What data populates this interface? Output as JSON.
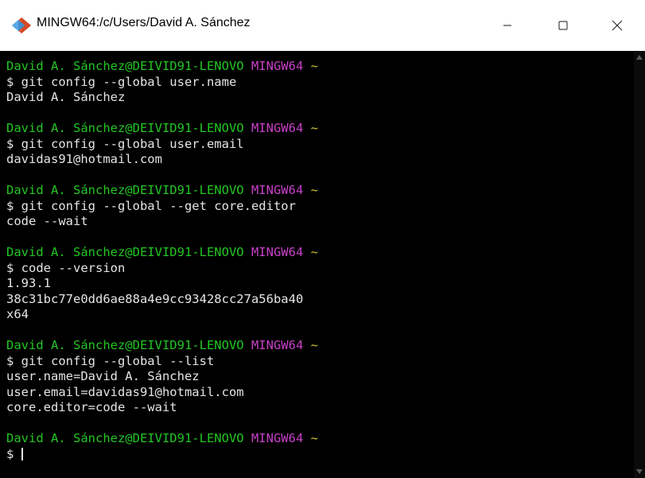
{
  "window": {
    "title": "MINGW64:/c/Users/David A. Sánchez",
    "app_icon": "git-bash-icon",
    "buttons": {
      "minimize_icon": "minimize-icon",
      "maximize_icon": "maximize-icon",
      "close_icon": "close-icon"
    }
  },
  "colors": {
    "user_host": "#23c623",
    "system": "#c840c8",
    "tilde": "#d6c43a",
    "text": "#e5e5e5",
    "background": "#000000"
  },
  "terminal": {
    "blocks": [
      {
        "prompt": {
          "user_host": "David A. Sánchez@DEIVID91-LENOVO",
          "system": "MINGW64",
          "path": "~"
        },
        "command": "$ git config --global user.name",
        "output": [
          "David A. Sánchez"
        ]
      },
      {
        "prompt": {
          "user_host": "David A. Sánchez@DEIVID91-LENOVO",
          "system": "MINGW64",
          "path": "~"
        },
        "command": "$ git config --global user.email",
        "output": [
          "davidas91@hotmail.com"
        ]
      },
      {
        "prompt": {
          "user_host": "David A. Sánchez@DEIVID91-LENOVO",
          "system": "MINGW64",
          "path": "~"
        },
        "command": "$ git config --global --get core.editor",
        "output": [
          "code --wait"
        ]
      },
      {
        "prompt": {
          "user_host": "David A. Sánchez@DEIVID91-LENOVO",
          "system": "MINGW64",
          "path": "~"
        },
        "command": "$ code --version",
        "output": [
          "1.93.1",
          "38c31bc77e0dd6ae88a4e9cc93428cc27a56ba40",
          "x64"
        ]
      },
      {
        "prompt": {
          "user_host": "David A. Sánchez@DEIVID91-LENOVO",
          "system": "MINGW64",
          "path": "~"
        },
        "command": "$ git config --global --list",
        "output": [
          "user.name=David A. Sánchez",
          "user.email=davidas91@hotmail.com",
          "core.editor=code --wait"
        ]
      }
    ],
    "final_prompt": {
      "user_host": "David A. Sánchez@DEIVID91-LENOVO",
      "system": "MINGW64",
      "path": "~"
    },
    "input_line": "$ "
  }
}
